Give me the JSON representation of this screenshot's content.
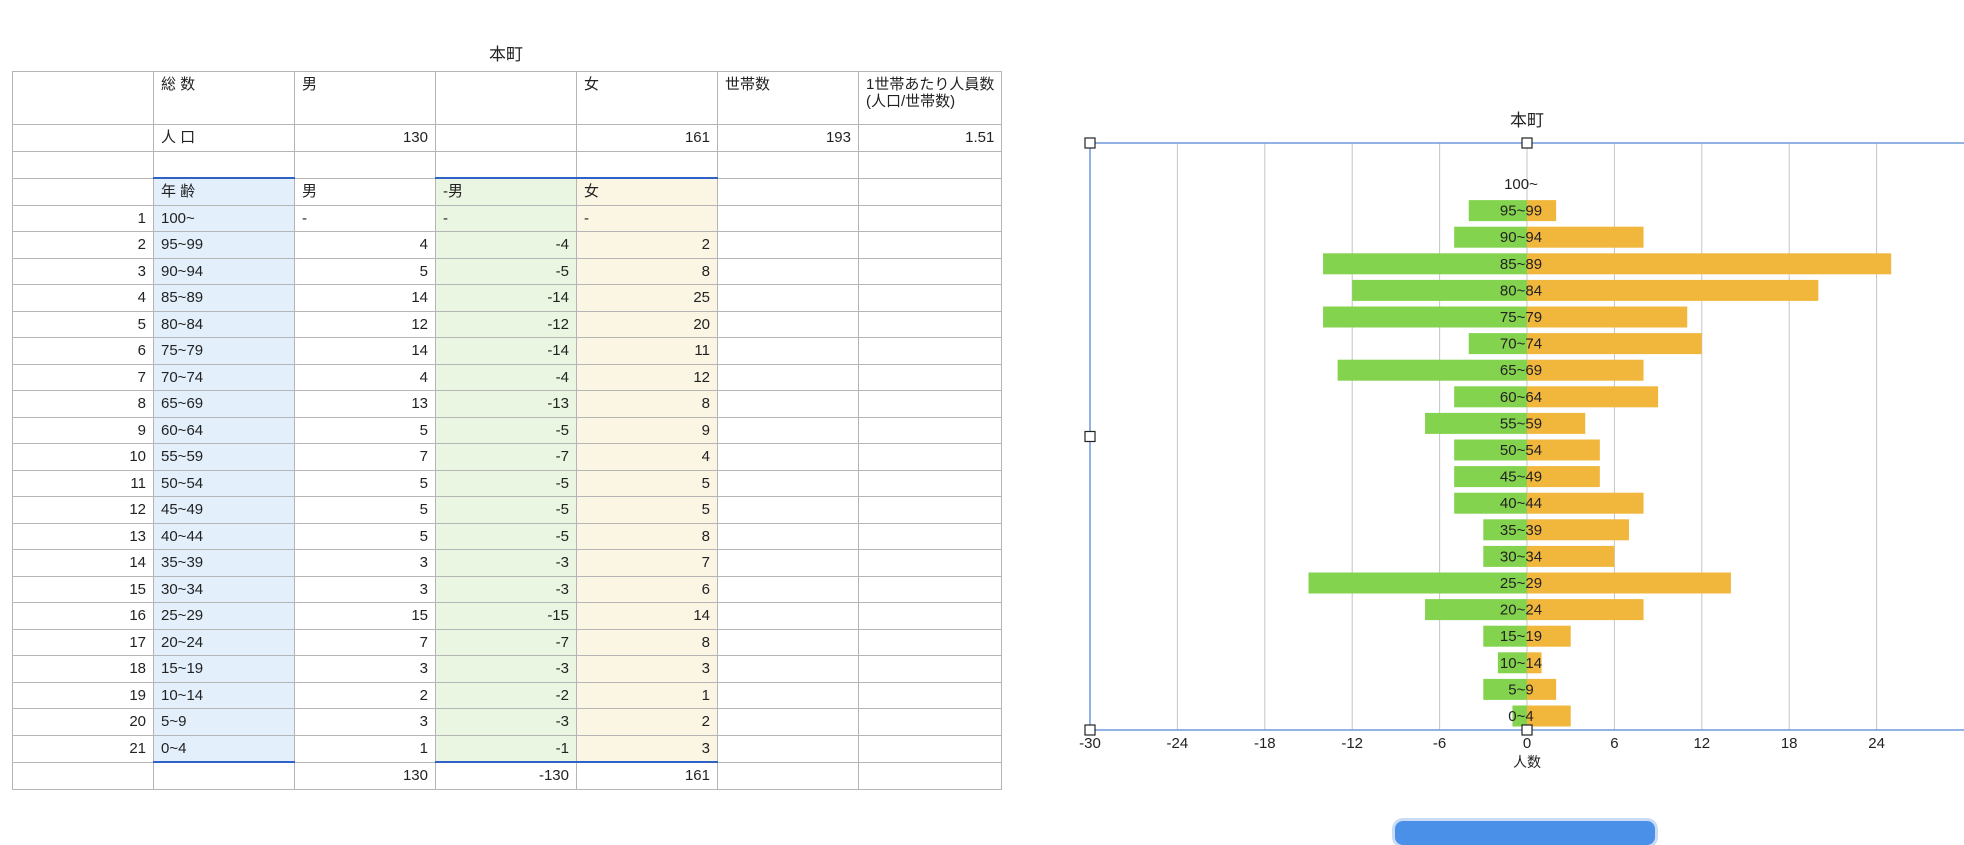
{
  "sheet": {
    "title": "本町",
    "header": {
      "total": "総 数",
      "male": "男",
      "female": "女",
      "households": "世帯数",
      "per_household_line1": "1世帯あたり人員数",
      "per_household_line2": "(人口/世帯数)"
    },
    "population": {
      "label": "人 口",
      "male": "130",
      "female": "161",
      "households": "193",
      "per_household": "1.51"
    },
    "sub_header": {
      "age": "年 齢",
      "male": "男",
      "neg_male": "-男",
      "female": "女"
    },
    "rows": [
      {
        "n": "1",
        "age": "100~",
        "male": "-",
        "neg": "-",
        "female": "-"
      },
      {
        "n": "2",
        "age": "95~99",
        "male": "4",
        "neg": "-4",
        "female": "2"
      },
      {
        "n": "3",
        "age": "90~94",
        "male": "5",
        "neg": "-5",
        "female": "8"
      },
      {
        "n": "4",
        "age": "85~89",
        "male": "14",
        "neg": "-14",
        "female": "25"
      },
      {
        "n": "5",
        "age": "80~84",
        "male": "12",
        "neg": "-12",
        "female": "20"
      },
      {
        "n": "6",
        "age": "75~79",
        "male": "14",
        "neg": "-14",
        "female": "11"
      },
      {
        "n": "7",
        "age": "70~74",
        "male": "4",
        "neg": "-4",
        "female": "12"
      },
      {
        "n": "8",
        "age": "65~69",
        "male": "13",
        "neg": "-13",
        "female": "8"
      },
      {
        "n": "9",
        "age": "60~64",
        "male": "5",
        "neg": "-5",
        "female": "9"
      },
      {
        "n": "10",
        "age": "55~59",
        "male": "7",
        "neg": "-7",
        "female": "4"
      },
      {
        "n": "11",
        "age": "50~54",
        "male": "5",
        "neg": "-5",
        "female": "5"
      },
      {
        "n": "12",
        "age": "45~49",
        "male": "5",
        "neg": "-5",
        "female": "5"
      },
      {
        "n": "13",
        "age": "40~44",
        "male": "5",
        "neg": "-5",
        "female": "8"
      },
      {
        "n": "14",
        "age": "35~39",
        "male": "3",
        "neg": "-3",
        "female": "7"
      },
      {
        "n": "15",
        "age": "30~34",
        "male": "3",
        "neg": "-3",
        "female": "6"
      },
      {
        "n": "16",
        "age": "25~29",
        "male": "15",
        "neg": "-15",
        "female": "14"
      },
      {
        "n": "17",
        "age": "20~24",
        "male": "7",
        "neg": "-7",
        "female": "8"
      },
      {
        "n": "18",
        "age": "15~19",
        "male": "3",
        "neg": "-3",
        "female": "3"
      },
      {
        "n": "19",
        "age": "10~14",
        "male": "2",
        "neg": "-2",
        "female": "1"
      },
      {
        "n": "20",
        "age": "5~9",
        "male": "3",
        "neg": "-3",
        "female": "2"
      },
      {
        "n": "21",
        "age": "0~4",
        "male": "1",
        "neg": "-1",
        "female": "3"
      }
    ],
    "totals": {
      "male": "130",
      "neg": "-130",
      "female": "161"
    }
  },
  "chart_data": {
    "type": "bar",
    "orientation": "horizontal",
    "title": "本町",
    "xlabel": "人数",
    "ylabel": "",
    "categories": [
      "100~",
      "95~99",
      "90~94",
      "85~89",
      "80~84",
      "75~79",
      "70~74",
      "65~69",
      "60~64",
      "55~59",
      "50~54",
      "45~49",
      "40~44",
      "35~39",
      "30~34",
      "25~29",
      "20~24",
      "15~19",
      "10~14",
      "5~9",
      "0~4"
    ],
    "series": [
      {
        "values": [
          null,
          -4,
          -5,
          -14,
          -12,
          -14,
          -4,
          -13,
          -5,
          -7,
          -5,
          -5,
          -5,
          -3,
          -3,
          -15,
          -7,
          -3,
          -2,
          -3,
          -1
        ],
        "color": "#84d34e"
      },
      {
        "values": [
          null,
          2,
          8,
          25,
          20,
          11,
          12,
          8,
          9,
          4,
          5,
          5,
          8,
          7,
          6,
          14,
          8,
          3,
          1,
          2,
          3
        ],
        "color": "#f1b73c"
      }
    ],
    "xlim": [
      -30,
      30
    ],
    "xticks": [
      -30,
      -24,
      -18,
      -12,
      -6,
      0,
      6,
      12,
      18,
      24
    ],
    "grid": true,
    "legend": "none",
    "selected": true
  }
}
